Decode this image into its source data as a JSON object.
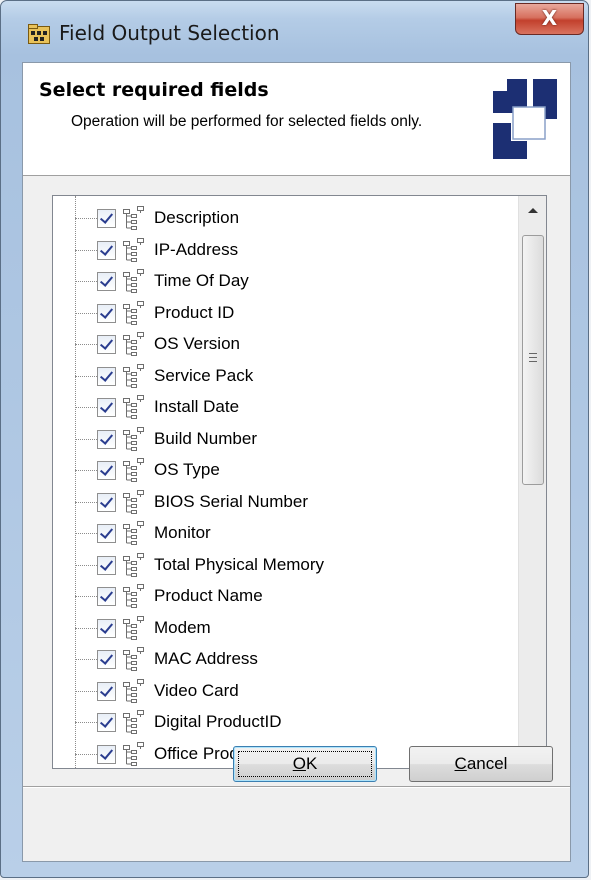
{
  "window": {
    "title": "Field Output Selection",
    "close_glyph": "X",
    "icon": "app-folder-icon"
  },
  "header": {
    "title": "Select required fields",
    "subtitle": "Operation will be performed for selected fields only.",
    "logo": "puzzle-logo-icon"
  },
  "fields": [
    {
      "label": "Description",
      "checked": true
    },
    {
      "label": "IP-Address",
      "checked": true
    },
    {
      "label": "Time Of Day",
      "checked": true
    },
    {
      "label": "Product ID",
      "checked": true
    },
    {
      "label": "OS Version",
      "checked": true
    },
    {
      "label": "Service Pack",
      "checked": true
    },
    {
      "label": "Install Date",
      "checked": true
    },
    {
      "label": "Build Number",
      "checked": true
    },
    {
      "label": "OS Type",
      "checked": true
    },
    {
      "label": "BIOS Serial Number",
      "checked": true
    },
    {
      "label": "Monitor",
      "checked": true
    },
    {
      "label": "Total Physical Memory",
      "checked": true
    },
    {
      "label": "Product Name",
      "checked": true
    },
    {
      "label": "Modem",
      "checked": true
    },
    {
      "label": "MAC Address",
      "checked": true
    },
    {
      "label": "Video Card",
      "checked": true
    },
    {
      "label": "Digital ProductID",
      "checked": true
    },
    {
      "label": "Office ProductID",
      "checked": true
    }
  ],
  "buttons": {
    "ok": {
      "mnemonic": "O",
      "rest": "K"
    },
    "cancel": {
      "mnemonic": "C",
      "rest": "ancel"
    }
  },
  "colors": {
    "check": "#2a3d8f",
    "logo_blue": "#1c2f73",
    "close_red": "#c2402c"
  }
}
